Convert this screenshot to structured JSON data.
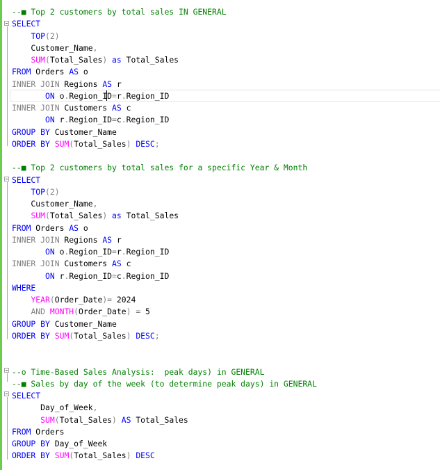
{
  "editor": {
    "lines": [
      [
        {
          "t": "--■ Top 2 customers by total sales IN GENERAL",
          "c": "comment"
        }
      ],
      [
        {
          "t": "SELECT",
          "c": "kw"
        }
      ],
      [
        {
          "t": "    ",
          "c": "text"
        },
        {
          "t": "TOP",
          "c": "kw"
        },
        {
          "t": "(2)",
          "c": "gray"
        }
      ],
      [
        {
          "t": "    Customer_Name",
          "c": "text"
        },
        {
          "t": ",",
          "c": "gray"
        }
      ],
      [
        {
          "t": "    ",
          "c": "text"
        },
        {
          "t": "SUM",
          "c": "fn"
        },
        {
          "t": "(",
          "c": "gray"
        },
        {
          "t": "Total_Sales",
          "c": "text"
        },
        {
          "t": ")",
          "c": "gray"
        },
        {
          "t": " ",
          "c": "text"
        },
        {
          "t": "as",
          "c": "kw"
        },
        {
          "t": " Total_Sales",
          "c": "text"
        }
      ],
      [
        {
          "t": "FROM",
          "c": "kw"
        },
        {
          "t": " Orders ",
          "c": "text"
        },
        {
          "t": "AS",
          "c": "kw"
        },
        {
          "t": " o",
          "c": "text"
        }
      ],
      [
        {
          "t": "INNER JOIN",
          "c": "gray"
        },
        {
          "t": " Regions ",
          "c": "text"
        },
        {
          "t": "AS",
          "c": "kw"
        },
        {
          "t": " r",
          "c": "text"
        }
      ],
      [
        {
          "t": "       ",
          "c": "text"
        },
        {
          "t": "ON",
          "c": "kw"
        },
        {
          "t": " o",
          "c": "text"
        },
        {
          "t": ".",
          "c": "gray"
        },
        {
          "t": "Region_ID",
          "c": "text"
        },
        {
          "t": "=",
          "c": "gray"
        },
        {
          "t": "r",
          "c": "text"
        },
        {
          "t": ".",
          "c": "gray"
        },
        {
          "t": "Region_ID",
          "c": "text"
        }
      ],
      [
        {
          "t": "INNER JOIN",
          "c": "gray"
        },
        {
          "t": " Customers ",
          "c": "text"
        },
        {
          "t": "AS",
          "c": "kw"
        },
        {
          "t": " c",
          "c": "text"
        }
      ],
      [
        {
          "t": "       ",
          "c": "text"
        },
        {
          "t": "ON",
          "c": "kw"
        },
        {
          "t": " r",
          "c": "text"
        },
        {
          "t": ".",
          "c": "gray"
        },
        {
          "t": "Region_ID",
          "c": "text"
        },
        {
          "t": "=",
          "c": "gray"
        },
        {
          "t": "c",
          "c": "text"
        },
        {
          "t": ".",
          "c": "gray"
        },
        {
          "t": "Region_ID",
          "c": "text"
        }
      ],
      [
        {
          "t": "GROUP BY",
          "c": "kw"
        },
        {
          "t": " Customer_Name",
          "c": "text"
        }
      ],
      [
        {
          "t": "ORDER BY",
          "c": "kw"
        },
        {
          "t": " ",
          "c": "text"
        },
        {
          "t": "SUM",
          "c": "fn"
        },
        {
          "t": "(",
          "c": "gray"
        },
        {
          "t": "Total_Sales",
          "c": "text"
        },
        {
          "t": ")",
          "c": "gray"
        },
        {
          "t": " ",
          "c": "text"
        },
        {
          "t": "DESC",
          "c": "kw"
        },
        {
          "t": ";",
          "c": "gray"
        }
      ],
      [],
      [
        {
          "t": "--■ Top 2 customers by total sales for a specific Year & Month",
          "c": "comment"
        }
      ],
      [
        {
          "t": "SELECT",
          "c": "kw"
        }
      ],
      [
        {
          "t": "    ",
          "c": "text"
        },
        {
          "t": "TOP",
          "c": "kw"
        },
        {
          "t": "(2)",
          "c": "gray"
        }
      ],
      [
        {
          "t": "    Customer_Name",
          "c": "text"
        },
        {
          "t": ",",
          "c": "gray"
        }
      ],
      [
        {
          "t": "    ",
          "c": "text"
        },
        {
          "t": "SUM",
          "c": "fn"
        },
        {
          "t": "(",
          "c": "gray"
        },
        {
          "t": "Total_Sales",
          "c": "text"
        },
        {
          "t": ")",
          "c": "gray"
        },
        {
          "t": " ",
          "c": "text"
        },
        {
          "t": "as",
          "c": "kw"
        },
        {
          "t": " Total_Sales",
          "c": "text"
        }
      ],
      [
        {
          "t": "FROM",
          "c": "kw"
        },
        {
          "t": " Orders ",
          "c": "text"
        },
        {
          "t": "AS",
          "c": "kw"
        },
        {
          "t": " o",
          "c": "text"
        }
      ],
      [
        {
          "t": "INNER JOIN",
          "c": "gray"
        },
        {
          "t": " Regions ",
          "c": "text"
        },
        {
          "t": "AS",
          "c": "kw"
        },
        {
          "t": " r",
          "c": "text"
        }
      ],
      [
        {
          "t": "       ",
          "c": "text"
        },
        {
          "t": "ON",
          "c": "kw"
        },
        {
          "t": " o",
          "c": "text"
        },
        {
          "t": ".",
          "c": "gray"
        },
        {
          "t": "Region_ID",
          "c": "text"
        },
        {
          "t": "=",
          "c": "gray"
        },
        {
          "t": "r",
          "c": "text"
        },
        {
          "t": ".",
          "c": "gray"
        },
        {
          "t": "Region_ID",
          "c": "text"
        }
      ],
      [
        {
          "t": "INNER JOIN",
          "c": "gray"
        },
        {
          "t": " Customers ",
          "c": "text"
        },
        {
          "t": "AS",
          "c": "kw"
        },
        {
          "t": " c",
          "c": "text"
        }
      ],
      [
        {
          "t": "       ",
          "c": "text"
        },
        {
          "t": "ON",
          "c": "kw"
        },
        {
          "t": " r",
          "c": "text"
        },
        {
          "t": ".",
          "c": "gray"
        },
        {
          "t": "Region_ID",
          "c": "text"
        },
        {
          "t": "=",
          "c": "gray"
        },
        {
          "t": "c",
          "c": "text"
        },
        {
          "t": ".",
          "c": "gray"
        },
        {
          "t": "Region_ID",
          "c": "text"
        }
      ],
      [
        {
          "t": "WHERE",
          "c": "kw"
        }
      ],
      [
        {
          "t": "    ",
          "c": "text"
        },
        {
          "t": "YEAR",
          "c": "fn"
        },
        {
          "t": "(",
          "c": "gray"
        },
        {
          "t": "Order_Date",
          "c": "text"
        },
        {
          "t": ")=",
          "c": "gray"
        },
        {
          "t": " 2024",
          "c": "text"
        }
      ],
      [
        {
          "t": "    ",
          "c": "text"
        },
        {
          "t": "AND",
          "c": "gray"
        },
        {
          "t": " ",
          "c": "text"
        },
        {
          "t": "MONTH",
          "c": "fn"
        },
        {
          "t": "(",
          "c": "gray"
        },
        {
          "t": "Order_Date",
          "c": "text"
        },
        {
          "t": ")",
          "c": "gray"
        },
        {
          "t": " ",
          "c": "text"
        },
        {
          "t": "=",
          "c": "gray"
        },
        {
          "t": " 5",
          "c": "text"
        }
      ],
      [
        {
          "t": "GROUP BY",
          "c": "kw"
        },
        {
          "t": " Customer_Name",
          "c": "text"
        }
      ],
      [
        {
          "t": "ORDER BY",
          "c": "kw"
        },
        {
          "t": " ",
          "c": "text"
        },
        {
          "t": "SUM",
          "c": "fn"
        },
        {
          "t": "(",
          "c": "gray"
        },
        {
          "t": "Total_Sales",
          "c": "text"
        },
        {
          "t": ")",
          "c": "gray"
        },
        {
          "t": " ",
          "c": "text"
        },
        {
          "t": "DESC",
          "c": "kw"
        },
        {
          "t": ";",
          "c": "gray"
        }
      ],
      [],
      [],
      [
        {
          "t": "--o Time-Based Sales Analysis:  peak days) in GENERAL",
          "c": "comment"
        }
      ],
      [
        {
          "t": "--■ Sales by day of the week (to determine peak days) in GENERAL",
          "c": "comment"
        }
      ],
      [
        {
          "t": "SELECT",
          "c": "kw"
        }
      ],
      [
        {
          "t": "      Day_of_Week",
          "c": "text"
        },
        {
          "t": ",",
          "c": "gray"
        }
      ],
      [
        {
          "t": "      ",
          "c": "text"
        },
        {
          "t": "SUM",
          "c": "fn"
        },
        {
          "t": "(",
          "c": "gray"
        },
        {
          "t": "Total_Sales",
          "c": "text"
        },
        {
          "t": ")",
          "c": "gray"
        },
        {
          "t": " ",
          "c": "text"
        },
        {
          "t": "AS",
          "c": "kw"
        },
        {
          "t": " Total_Sales",
          "c": "text"
        }
      ],
      [
        {
          "t": "FROM",
          "c": "kw"
        },
        {
          "t": " Orders",
          "c": "text"
        }
      ],
      [
        {
          "t": "GROUP BY",
          "c": "kw"
        },
        {
          "t": " Day_of_Week",
          "c": "text"
        }
      ],
      [
        {
          "t": "ORDER BY",
          "c": "kw"
        },
        {
          "t": " ",
          "c": "text"
        },
        {
          "t": "SUM",
          "c": "fn"
        },
        {
          "t": "(",
          "c": "gray"
        },
        {
          "t": "Total_Sales",
          "c": "text"
        },
        {
          "t": ")",
          "c": "gray"
        },
        {
          "t": " ",
          "c": "text"
        },
        {
          "t": "DESC",
          "c": "kw"
        }
      ]
    ],
    "colors": {
      "comment": "#008000",
      "keyword": "#0000ff",
      "function": "#ff00ff",
      "operator": "#808080",
      "text": "#000000",
      "change_bar": "#6ccc4e"
    }
  }
}
